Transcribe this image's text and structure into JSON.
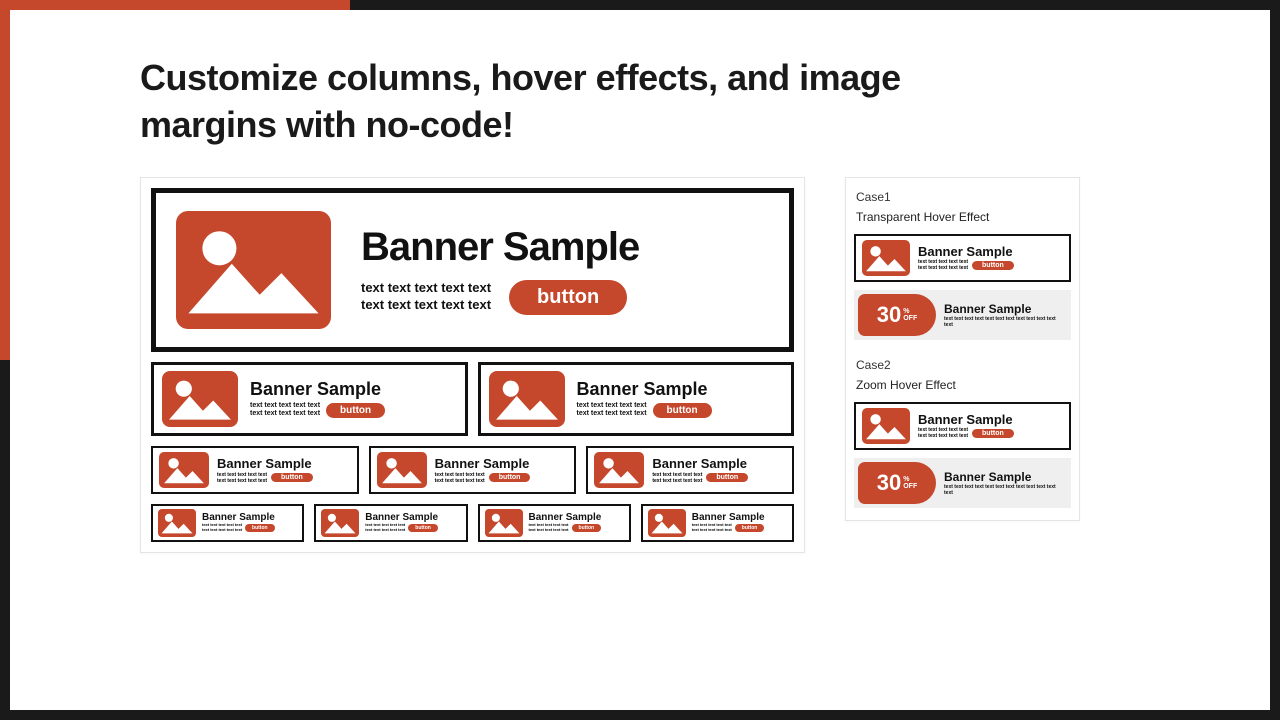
{
  "colors": {
    "accent": "#c5472c",
    "dark": "#1a1a1a"
  },
  "heading": "Customize columns, hover effects, and image margins with no-code!",
  "banner": {
    "title": "Banner Sample",
    "text_line": "text text text text text",
    "text_two_lines": "text text text text text\ntext text text text text",
    "sale_text": "text text text text text text text text text text text text",
    "button": "button"
  },
  "sale": {
    "number": "30",
    "unit_top": "%",
    "unit_bottom": "OFF"
  },
  "cases": [
    {
      "label": "Case1",
      "title": "Transparent Hover Effect"
    },
    {
      "label": "Case2",
      "title": "Zoom Hover Effect"
    }
  ]
}
